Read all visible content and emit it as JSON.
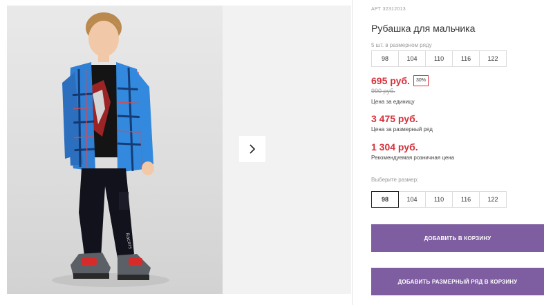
{
  "product": {
    "article": "АРТ 32312013",
    "title": "Рубашка для мальчика",
    "set_note": "5 шт. в размерном ряду",
    "set_sizes": [
      "98",
      "104",
      "110",
      "116",
      "122"
    ],
    "price": "695 руб.",
    "discount": "30%",
    "old_price": "990 руб.",
    "price_unit_label": "Цена за единицу",
    "set_price": "3 475 руб.",
    "set_price_label": "Цена за размерный ряд",
    "rrp": "1 304 руб.",
    "rrp_label": "Рекомендуемая розничная цена",
    "choose_size_label": "Выберите размер:",
    "sizes": [
      "98",
      "104",
      "110",
      "116",
      "122"
    ],
    "selected_size": "98"
  },
  "actions": {
    "add_to_cart": "ДОБАВИТЬ В КОРЗИНУ",
    "add_set_to_cart": "ДОБАВИТЬ РАЗМЕРНЫЙ РЯД В КОРЗИНУ"
  },
  "colors": {
    "accent": "#7e5da0",
    "price": "#d6313b"
  },
  "icons": {
    "gallery_next": "chevron-right-icon"
  }
}
